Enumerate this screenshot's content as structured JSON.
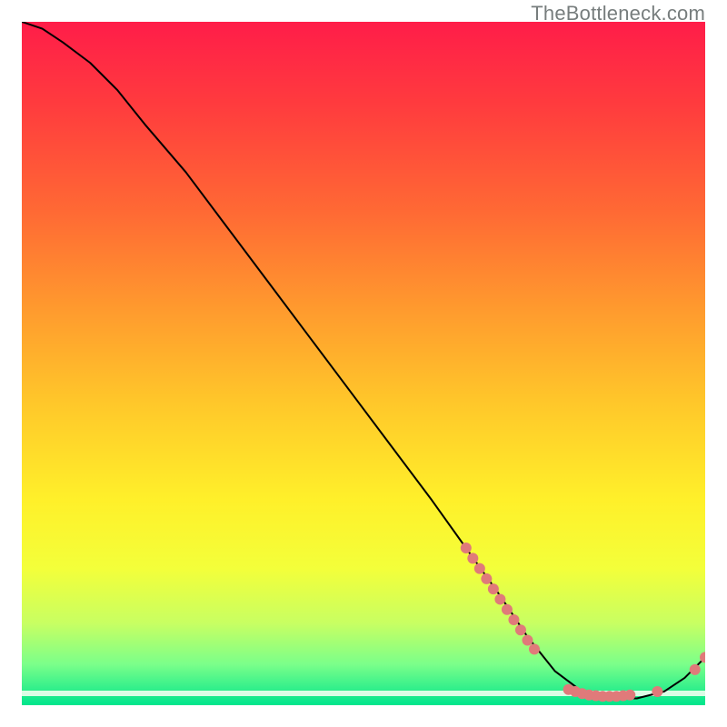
{
  "watermark": "TheBottleneck.com",
  "chart_data": {
    "type": "line",
    "title": "",
    "xlabel": "",
    "ylabel": "",
    "xlim": [
      0,
      100
    ],
    "ylim": [
      0,
      100
    ],
    "grid": false,
    "legend": false,
    "gradient": {
      "direction": "vertical",
      "stops": [
        {
          "pos": 0,
          "color": "#ff1d49"
        },
        {
          "pos": 12,
          "color": "#ff3b3e"
        },
        {
          "pos": 28,
          "color": "#ff6a34"
        },
        {
          "pos": 42,
          "color": "#ff9a2e"
        },
        {
          "pos": 56,
          "color": "#ffc82a"
        },
        {
          "pos": 70,
          "color": "#fff02a"
        },
        {
          "pos": 80,
          "color": "#f3ff3a"
        },
        {
          "pos": 88,
          "color": "#c8ff62"
        },
        {
          "pos": 94,
          "color": "#7bff8a"
        },
        {
          "pos": 100,
          "color": "#00e58c"
        }
      ]
    },
    "series": [
      {
        "name": "curve",
        "color": "#000000",
        "stroke_width": 2,
        "x": [
          0,
          3,
          6,
          10,
          14,
          18,
          24,
          30,
          36,
          42,
          48,
          54,
          60,
          65,
          70,
          74,
          78,
          82,
          86,
          90,
          94,
          97,
          100
        ],
        "y": [
          100,
          99,
          97,
          94,
          90,
          85,
          78,
          70,
          62,
          54,
          46,
          38,
          30,
          23,
          16,
          10,
          5,
          2,
          1,
          1,
          2,
          4,
          7
        ]
      }
    ],
    "scatter": [
      {
        "name": "cluster-descent",
        "color": "#e07a7a",
        "radius": 6,
        "points": [
          {
            "x": 65,
            "y": 23
          },
          {
            "x": 66,
            "y": 21.5
          },
          {
            "x": 67,
            "y": 20
          },
          {
            "x": 68,
            "y": 18.5
          },
          {
            "x": 69,
            "y": 17
          },
          {
            "x": 70,
            "y": 15.5
          },
          {
            "x": 71,
            "y": 14
          },
          {
            "x": 72,
            "y": 12.5
          },
          {
            "x": 73,
            "y": 11
          },
          {
            "x": 74,
            "y": 9.5
          },
          {
            "x": 75,
            "y": 8.2
          }
        ]
      },
      {
        "name": "cluster-valley",
        "color": "#e07a7a",
        "radius": 6,
        "points": [
          {
            "x": 80,
            "y": 2.3
          },
          {
            "x": 81,
            "y": 2.0
          },
          {
            "x": 82,
            "y": 1.7
          },
          {
            "x": 83,
            "y": 1.5
          },
          {
            "x": 84,
            "y": 1.4
          },
          {
            "x": 85,
            "y": 1.3
          },
          {
            "x": 86,
            "y": 1.3
          },
          {
            "x": 87,
            "y": 1.3
          },
          {
            "x": 88,
            "y": 1.4
          },
          {
            "x": 89,
            "y": 1.5
          },
          {
            "x": 93,
            "y": 2.0
          }
        ]
      },
      {
        "name": "cluster-tail",
        "color": "#e07a7a",
        "radius": 6,
        "points": [
          {
            "x": 98.5,
            "y": 5.2
          },
          {
            "x": 100,
            "y": 7.0
          }
        ]
      }
    ]
  }
}
